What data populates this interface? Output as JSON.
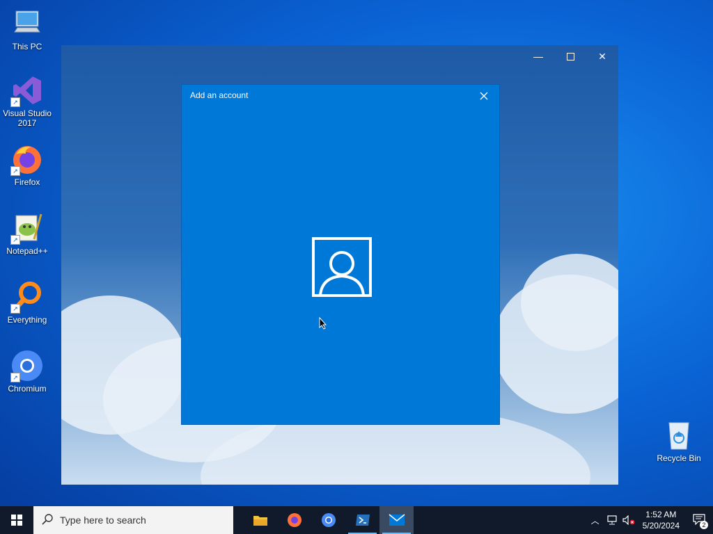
{
  "desktop": {
    "icons": [
      {
        "label": "This PC"
      },
      {
        "label": "Visual Studio 2017"
      },
      {
        "label": "Firefox"
      },
      {
        "label": "Notepad++"
      },
      {
        "label": "Everything"
      },
      {
        "label": "Chromium"
      },
      {
        "label": "Recycle Bin"
      }
    ]
  },
  "dialog": {
    "title": "Add an account"
  },
  "taskbar": {
    "search_placeholder": "Type here to search",
    "time": "1:52 AM",
    "date": "5/20/2024",
    "notification_count": "2"
  },
  "colors": {
    "dialog_bg": "#0078d7",
    "taskbar_bg": "#101a2a"
  }
}
